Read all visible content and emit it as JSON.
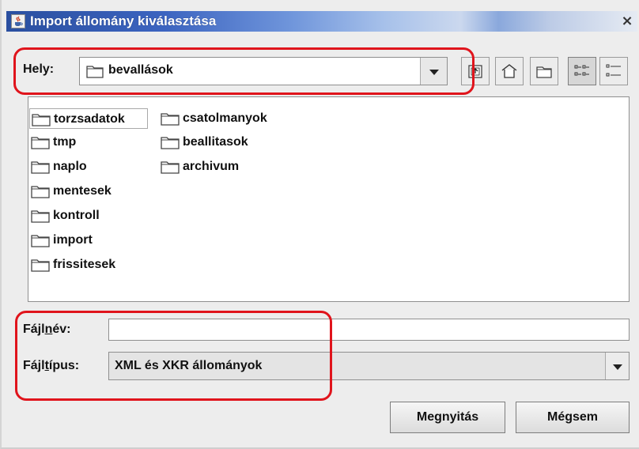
{
  "dialog": {
    "title": "Import állomány kiválasztása",
    "title_icon": "java-cup-icon",
    "close_label": "×"
  },
  "location": {
    "label": "Hely:",
    "value": "bevallások"
  },
  "toolbar": {
    "icons": [
      "up-folder-icon",
      "home-icon",
      "new-folder-icon",
      "list-view-icon",
      "details-view-icon"
    ],
    "active_view": "list-view-icon"
  },
  "files": {
    "column1": [
      "torzsadatok",
      "tmp",
      "naplo",
      "mentesek",
      "kontroll",
      "import",
      "frissitesek"
    ],
    "column2": [
      "csatolmanyok",
      "beallitasok",
      "archivum"
    ],
    "selected": "torzsadatok"
  },
  "filename": {
    "label_pre": "Fájl",
    "label_mnemonic": "n",
    "label_post": "év:",
    "value": ""
  },
  "filetype": {
    "label_pre": "Fájl",
    "label_mnemonic": "t",
    "label_post": "ípus:",
    "value": "XML és XKR állományok"
  },
  "buttons": {
    "open": "Megnyitás",
    "cancel": "Mégsem"
  },
  "colors": {
    "highlight": "#e0141c",
    "titlebar_start": "#2a4fa0"
  }
}
